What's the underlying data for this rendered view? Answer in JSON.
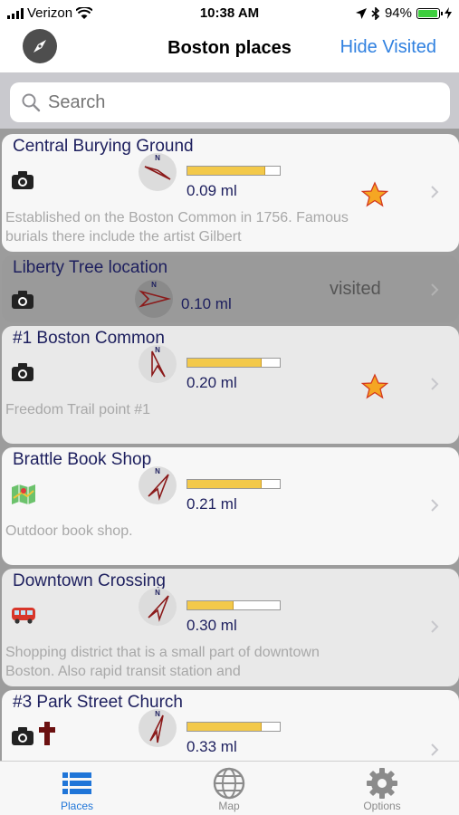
{
  "status": {
    "carrier": "Verizon",
    "time": "10:38 AM",
    "battery": "94%"
  },
  "nav": {
    "title": "Boston places",
    "hide_visited": "Hide Visited"
  },
  "search": {
    "placeholder": "Search"
  },
  "places": [
    {
      "title": "Central Burying Ground",
      "distance": "0.09 ml",
      "desc": "Established on the Boston Common in 1756. Famous burials there include the artist Gilbert",
      "icon": "camera-icon",
      "star": true,
      "visited": false,
      "meter_fill": 0.85
    },
    {
      "title": "Liberty Tree location",
      "distance": "0.10 ml",
      "desc": "",
      "icon": "camera-icon",
      "star": false,
      "visited": true,
      "visited_label": "visited",
      "meter_fill": 0.8
    },
    {
      "title": "#1 Boston Common",
      "distance": "0.20 ml",
      "desc": "Freedom Trail point #1",
      "icon": "camera-icon",
      "star": true,
      "visited": false,
      "meter_fill": 0.8
    },
    {
      "title": "Brattle Book Shop",
      "distance": "0.21 ml",
      "desc": "Outdoor book shop.",
      "icon": "map-icon",
      "star": false,
      "visited": false,
      "meter_fill": 0.8
    },
    {
      "title": "Downtown Crossing",
      "distance": "0.30 ml",
      "desc": "Shopping district that is a small part of downtown Boston. Also rapid transit station and",
      "icon": "bus-icon",
      "star": false,
      "visited": false,
      "meter_fill": 0.5
    },
    {
      "title": "#3 Park Street Church",
      "distance": "0.33 ml",
      "desc": "",
      "icon": "camera-icon",
      "star": false,
      "visited": false,
      "meter_fill": 0.8
    }
  ],
  "tabs": [
    {
      "label": "Places",
      "icon": "list-icon",
      "active": true
    },
    {
      "label": "Map",
      "icon": "globe-icon",
      "active": false
    },
    {
      "label": "Options",
      "icon": "gear-icon",
      "active": false
    }
  ],
  "colors": {
    "accent": "#2f80e0",
    "title_text": "#1d1f5e",
    "star": "#f5a623",
    "meter": "#f3c94a"
  }
}
